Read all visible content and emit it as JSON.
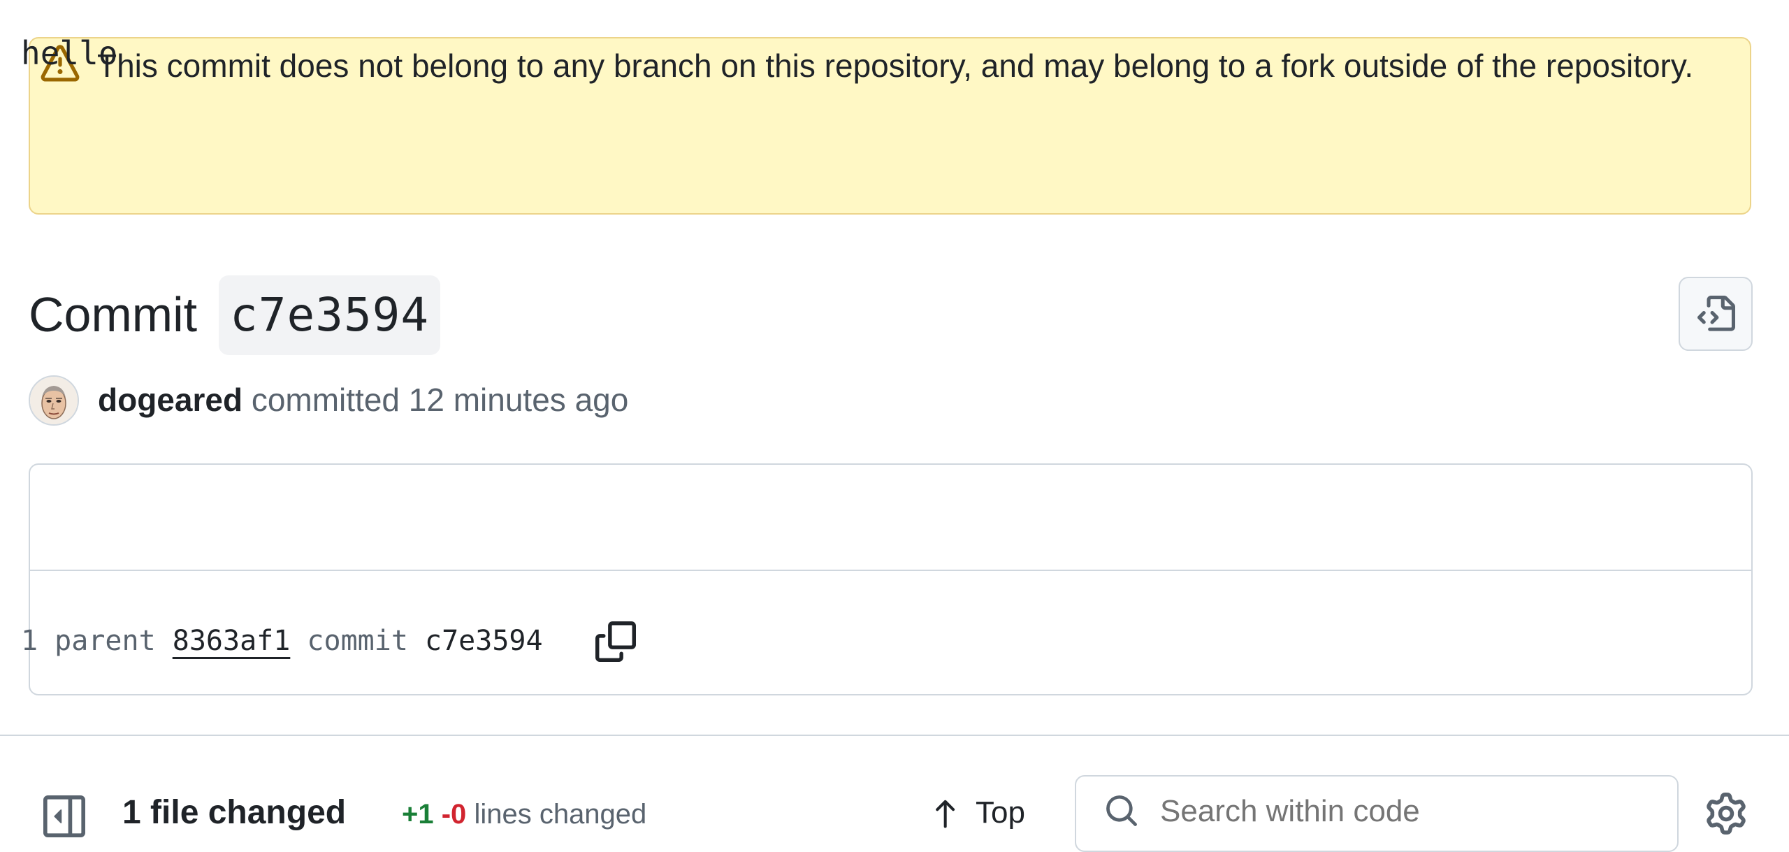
{
  "banner": {
    "text": "This commit does not belong to any branch on this repository, and may belong to a fork outside of the repository.",
    "icon": "alert-icon"
  },
  "commit": {
    "title_word": "Commit",
    "short_sha": "c7e3594",
    "message": "hello",
    "parent_label": "1 parent",
    "parent_sha": "8363af1",
    "commit_label": "commit",
    "commit_sha": "c7e3594"
  },
  "author": {
    "name": "dogeared",
    "action": "committed",
    "time": "12 minutes ago"
  },
  "toolbar": {
    "files_changed": "1 file changed",
    "additions": "+1",
    "deletions": "-0",
    "lines_changed": "lines changed",
    "top_label": "Top",
    "search_placeholder": "Search within code"
  },
  "colors": {
    "banner_bg": "#fff8c5",
    "banner_border": "#ecd48a",
    "additions": "#1a7f37",
    "deletions": "#d1242f",
    "muted_text": "#59636e"
  }
}
